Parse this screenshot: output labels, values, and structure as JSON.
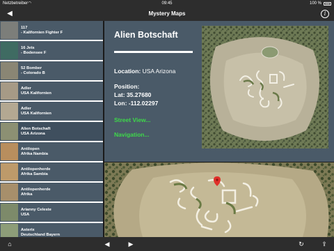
{
  "status": {
    "carrier": "Netzbetreiber",
    "time": "09:45",
    "battery": "100 %"
  },
  "nav": {
    "title": "Mystery Maps",
    "back_icon": "back-arrow-icon",
    "info_icon": "info-icon"
  },
  "list": [
    {
      "line1": "117",
      "line2": "- Kalifornien Fighter F",
      "thumb_color": "#7c7e7a"
    },
    {
      "line1": "16 Jets",
      "line2": "- Bodensee F",
      "thumb_color": "#3f6b62"
    },
    {
      "line1": "52 Bomber",
      "line2": "- Colorado B",
      "thumb_color": "#8a8674"
    },
    {
      "line1": "Adler",
      "line2": "USA Kalifornien",
      "thumb_color": "#a69a86"
    },
    {
      "line1": "Adler",
      "line2": "USA Kalifornien",
      "thumb_color": "#b3a892"
    },
    {
      "line1": "Alien Botschaft",
      "line2": "USA Arizona",
      "thumb_color": "#8c9073"
    },
    {
      "line1": "Antilopen",
      "line2": "Afrika Nambia",
      "thumb_color": "#b88e5e"
    },
    {
      "line1": "Antilopenherde",
      "line2": "Afrika Sambia",
      "thumb_color": "#bd9a6a"
    },
    {
      "line1": "Antilopenherde",
      "line2": "Afrika",
      "thumb_color": "#a78f6b"
    },
    {
      "line1": "Arianny Celeste",
      "line2": "USA",
      "thumb_color": "#7d8a6a"
    },
    {
      "line1": "Asterix",
      "line2": "Deutschland Bayern",
      "thumb_color": "#8d9d78"
    }
  ],
  "selected_index": 5,
  "detail": {
    "name": "Alien Botschaft",
    "location_label": "Location:",
    "location_value": "USA  Arizona",
    "position_label": "Position:",
    "lat": "Lat: 35.27680",
    "lon": "Lon: -112.02297",
    "street_view": "Street View...",
    "navigation": "Navigation..."
  },
  "colors": {
    "panel": "#4a5a68",
    "bars": "#2d2d2d",
    "link_green": "#3ed84a"
  },
  "toolbar": {
    "home_icon": "home-icon",
    "prev_icon": "previous-icon",
    "next_icon": "next-icon",
    "reload_icon": "reload-icon",
    "share_icon": "share-icon"
  }
}
